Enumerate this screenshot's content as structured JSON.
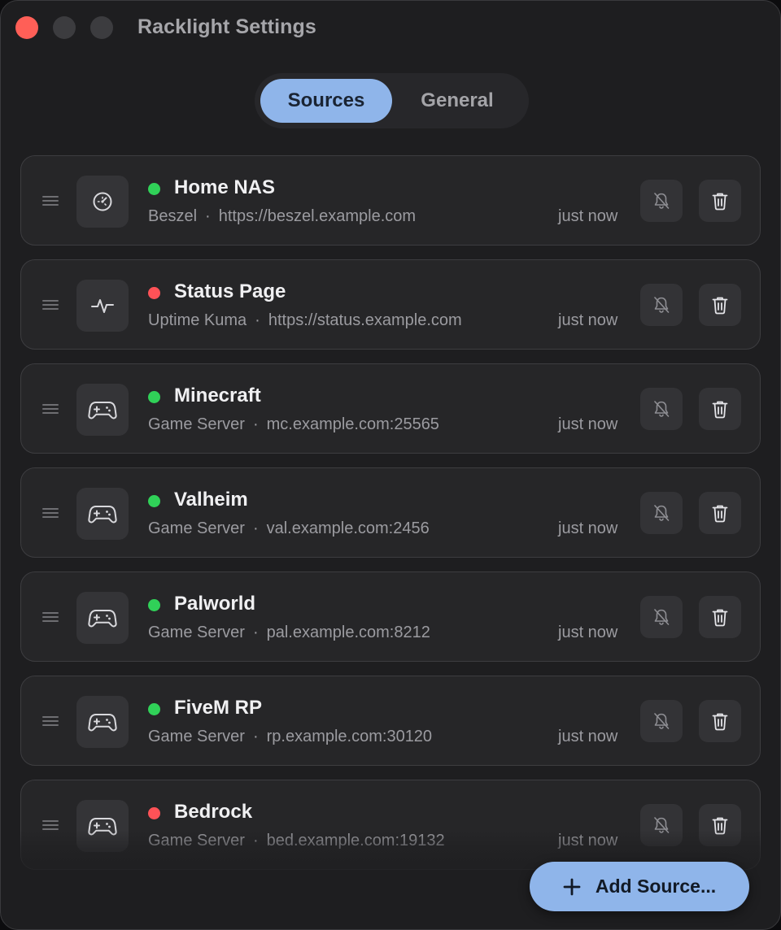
{
  "window": {
    "title": "Racklight Settings"
  },
  "tabs": [
    {
      "label": "Sources",
      "active": true
    },
    {
      "label": "General",
      "active": false
    }
  ],
  "sources": [
    {
      "name": "Home NAS",
      "type": "Beszel",
      "url": "https://beszel.example.com",
      "updated": "just now",
      "status": "up",
      "icon": "gauge-icon"
    },
    {
      "name": "Status Page",
      "type": "Uptime Kuma",
      "url": "https://status.example.com",
      "updated": "just now",
      "status": "down",
      "icon": "pulse-icon"
    },
    {
      "name": "Minecraft",
      "type": "Game Server",
      "url": "mc.example.com:25565",
      "updated": "just now",
      "status": "up",
      "icon": "gamepad-icon"
    },
    {
      "name": "Valheim",
      "type": "Game Server",
      "url": "val.example.com:2456",
      "updated": "just now",
      "status": "up",
      "icon": "gamepad-icon"
    },
    {
      "name": "Palworld",
      "type": "Game Server",
      "url": "pal.example.com:8212",
      "updated": "just now",
      "status": "up",
      "icon": "gamepad-icon"
    },
    {
      "name": "FiveM RP",
      "type": "Game Server",
      "url": "rp.example.com:30120",
      "updated": "just now",
      "status": "up",
      "icon": "gamepad-icon"
    },
    {
      "name": "Bedrock",
      "type": "Game Server",
      "url": "bed.example.com:19132",
      "updated": "just now",
      "status": "down",
      "icon": "gamepad-icon"
    }
  ],
  "row_separator": "·",
  "row_actions": {
    "mute_icon": "bell-slash-icon",
    "delete_icon": "trash-icon"
  },
  "add_button": {
    "label": "Add Source...",
    "icon": "plus-icon"
  },
  "colors": {
    "accent": "#8fb5ea",
    "status_up": "#30d158",
    "status_down": "#ff5257",
    "close": "#ff5f57"
  }
}
